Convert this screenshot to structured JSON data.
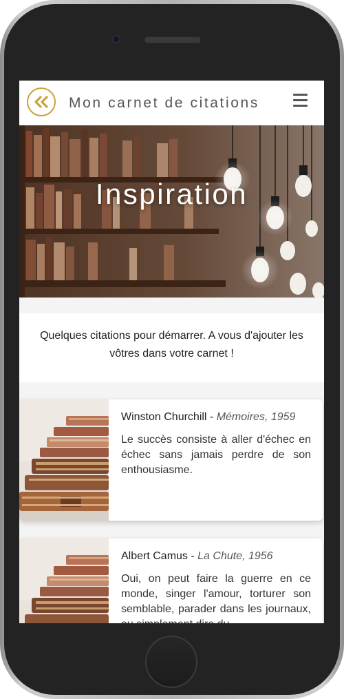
{
  "header": {
    "title": "Mon carnet de citations",
    "back_icon": "double-chevron-left-icon",
    "menu_icon": "hamburger-menu-icon"
  },
  "hero": {
    "title": "Inspiration"
  },
  "intro": {
    "text": "Quelques citations pour démarrer. A vous d'ajouter les vôtres dans votre carnet !"
  },
  "quotes": [
    {
      "author": "Winston Churchill",
      "separator": " - ",
      "work": "Mémoires, 1959",
      "text": "Le succès consiste à aller d'échec en échec sans jamais perdre de son enthousiasme."
    },
    {
      "author": "Albert Camus",
      "separator": " - ",
      "work": "La Chute, 1956",
      "text": "Oui, on peut faire la guerre en ce monde, singer l'amour, torturer son semblable, parader dans les journaux, ou simplement dire du"
    }
  ],
  "colors": {
    "accent": "#c8a23a",
    "title_text": "#555555",
    "background": "#f4f4f4"
  }
}
